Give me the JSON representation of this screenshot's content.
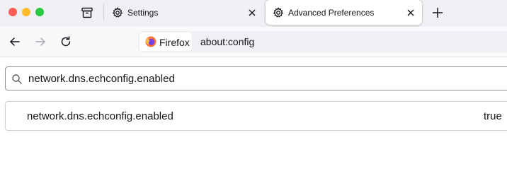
{
  "tabs": [
    {
      "label": "Settings",
      "icon": "gear-icon",
      "active": false
    },
    {
      "label": "Advanced Preferences",
      "icon": "gear-icon",
      "active": true
    }
  ],
  "urlbar": {
    "identity_label": "Firefox",
    "url": "about:config"
  },
  "search": {
    "value": "network.dns.echconfig.enabled"
  },
  "prefs": [
    {
      "name": "network.dns.echconfig.enabled",
      "value": "true"
    }
  ],
  "colors": {
    "traffic_close": "#ff5f57",
    "traffic_minimize": "#febc2e",
    "traffic_maximize": "#28c840",
    "tabstrip_bg": "#f0f0f4",
    "text": "#15141a"
  }
}
